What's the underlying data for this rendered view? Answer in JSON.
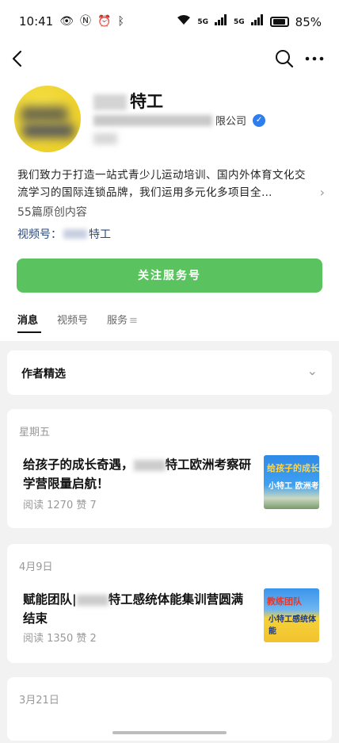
{
  "status_bar": {
    "time": "10:41",
    "battery": "85%",
    "signal": "5G"
  },
  "profile": {
    "name_suffix": "特工",
    "company_suffix": "限公司",
    "description": "我们致力于打造一站式青少儿运动培训、国内外体育文化交流学习的国际连锁品牌，我们运用多元化多项目全…",
    "original_count": "55篇原创内容",
    "video_prefix": "视频号：",
    "video_suffix": "特工"
  },
  "follow_button": {
    "label": "关注服务号"
  },
  "tabs": [
    "消息",
    "视频号",
    "服务"
  ],
  "author_picks": {
    "label": "作者精选"
  },
  "articles": [
    {
      "day": "星期五",
      "title_before": "给孩子的成长奇遇，",
      "title_after": "特工欧洲考察研学营限量启航！",
      "meta": "阅读 1270  赞 7",
      "thumb_line1": "给孩子的成长",
      "thumb_line2": "小特工 欧洲考"
    },
    {
      "day": "4月9日",
      "title_before": "赋能团队|",
      "title_after": "特工感统体能集训营圆满结束",
      "meta": "阅读 1350  赞 2",
      "thumb_line1": "教练团队",
      "thumb_line2": "小特工感统体能"
    },
    {
      "day": "3月21日"
    }
  ]
}
